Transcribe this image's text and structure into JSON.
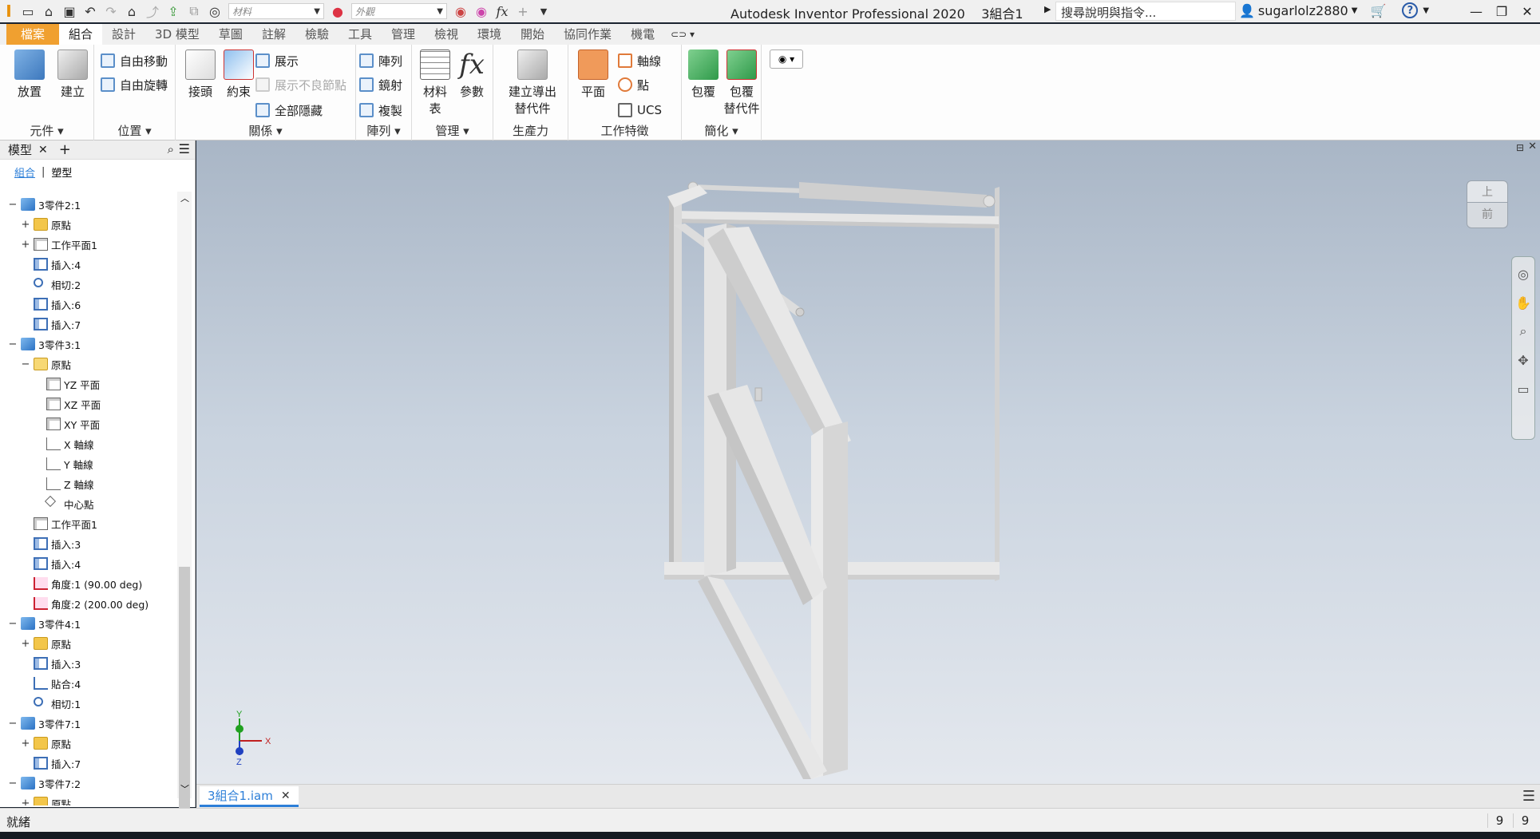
{
  "app": {
    "title": "Autodesk Inventor Professional 2020",
    "document": "3組合1",
    "material_placeholder": "材料",
    "appearance_placeholder": "外觀",
    "help_search": "搜尋說明與指令...",
    "username": "sugarlolz2880"
  },
  "tabs": [
    "檔案",
    "組合",
    "設計",
    "3D 模型",
    "草圖",
    "註解",
    "檢驗",
    "工具",
    "管理",
    "檢視",
    "環境",
    "開始",
    "協同作業",
    "機電"
  ],
  "active_tab": "組合",
  "ribbon": {
    "panels": {
      "component": "元件",
      "position": "位置",
      "relationships": "關係",
      "pattern": "陣列",
      "manage": "管理",
      "productivity": "生產力",
      "work_features": "工作特徵",
      "simplification": "簡化"
    },
    "buttons": {
      "place": "放置",
      "create": "建立",
      "free_move": "自由移動",
      "free_rotate": "自由旋轉",
      "joint": "接頭",
      "constrain": "約束",
      "show": "展示",
      "show_sick": "展示不良節點",
      "hide_all": "全部隱藏",
      "pattern": "陣列",
      "mirror": "鏡射",
      "copy": "複製",
      "bom_line1": "材料",
      "bom_line2": "表",
      "parameters": "參數",
      "derive_line1": "建立導出",
      "derive_line2": "替代件",
      "plane": "平面",
      "axis": "軸線",
      "point": "點",
      "ucs": "UCS",
      "shrinkwrap": "包覆",
      "shrinkwrap_sub_line1": "包覆",
      "shrinkwrap_sub_line2": "替代件"
    }
  },
  "browser": {
    "title": "模型",
    "add": "+",
    "views": [
      "組合",
      "塑型"
    ],
    "tree": [
      {
        "depth": 0,
        "toggle": "−",
        "icon": "part",
        "label": "3零件2:1"
      },
      {
        "depth": 1,
        "toggle": "+",
        "icon": "folder",
        "label": "原點"
      },
      {
        "depth": 1,
        "toggle": "+",
        "icon": "plane",
        "label": "工作平面1"
      },
      {
        "depth": 1,
        "toggle": "",
        "icon": "insert",
        "label": "插入:4"
      },
      {
        "depth": 1,
        "toggle": "",
        "icon": "tangent",
        "label": "相切:2"
      },
      {
        "depth": 1,
        "toggle": "",
        "icon": "insert",
        "label": "插入:6"
      },
      {
        "depth": 1,
        "toggle": "",
        "icon": "insert",
        "label": "插入:7"
      },
      {
        "depth": 0,
        "toggle": "−",
        "icon": "part",
        "label": "3零件3:1"
      },
      {
        "depth": 1,
        "toggle": "−",
        "icon": "folder-open",
        "label": "原點"
      },
      {
        "depth": 2,
        "toggle": "",
        "icon": "plane",
        "label": "YZ 平面"
      },
      {
        "depth": 2,
        "toggle": "",
        "icon": "plane",
        "label": "XZ 平面"
      },
      {
        "depth": 2,
        "toggle": "",
        "icon": "plane",
        "label": "XY 平面"
      },
      {
        "depth": 2,
        "toggle": "",
        "icon": "axis",
        "label": "X 軸線"
      },
      {
        "depth": 2,
        "toggle": "",
        "icon": "axis",
        "label": "Y 軸線"
      },
      {
        "depth": 2,
        "toggle": "",
        "icon": "axis",
        "label": "Z 軸線"
      },
      {
        "depth": 2,
        "toggle": "",
        "icon": "point",
        "label": "中心點"
      },
      {
        "depth": 1,
        "toggle": "",
        "icon": "plane",
        "label": "工作平面1"
      },
      {
        "depth": 1,
        "toggle": "",
        "icon": "insert",
        "label": "插入:3"
      },
      {
        "depth": 1,
        "toggle": "",
        "icon": "insert",
        "label": "插入:4"
      },
      {
        "depth": 1,
        "toggle": "",
        "icon": "angle",
        "label": "角度:1 (90.00 deg)"
      },
      {
        "depth": 1,
        "toggle": "",
        "icon": "angle",
        "label": "角度:2 (200.00 deg)"
      },
      {
        "depth": 0,
        "toggle": "−",
        "icon": "part",
        "label": "3零件4:1"
      },
      {
        "depth": 1,
        "toggle": "+",
        "icon": "folder",
        "label": "原點"
      },
      {
        "depth": 1,
        "toggle": "",
        "icon": "insert",
        "label": "插入:3"
      },
      {
        "depth": 1,
        "toggle": "",
        "icon": "mate",
        "label": "貼合:4"
      },
      {
        "depth": 1,
        "toggle": "",
        "icon": "tangent",
        "label": "相切:1"
      },
      {
        "depth": 0,
        "toggle": "−",
        "icon": "part",
        "label": "3零件7:1"
      },
      {
        "depth": 1,
        "toggle": "+",
        "icon": "folder",
        "label": "原點"
      },
      {
        "depth": 1,
        "toggle": "",
        "icon": "insert",
        "label": "插入:7"
      },
      {
        "depth": 0,
        "toggle": "−",
        "icon": "part",
        "label": "3零件7:2"
      },
      {
        "depth": 1,
        "toggle": "+",
        "icon": "folder",
        "label": "原點"
      }
    ]
  },
  "viewcube": {
    "top": "上",
    "front": "前"
  },
  "triad": {
    "x": "X",
    "y": "Y",
    "z": "Z"
  },
  "doc_tab": "3組合1.iam",
  "status": {
    "text": "就緒",
    "count1": "9",
    "count2": "9"
  },
  "colors": {
    "accent": "#2d7fd8",
    "file_tab": "#f0a030",
    "model": "#e2e2e2"
  }
}
